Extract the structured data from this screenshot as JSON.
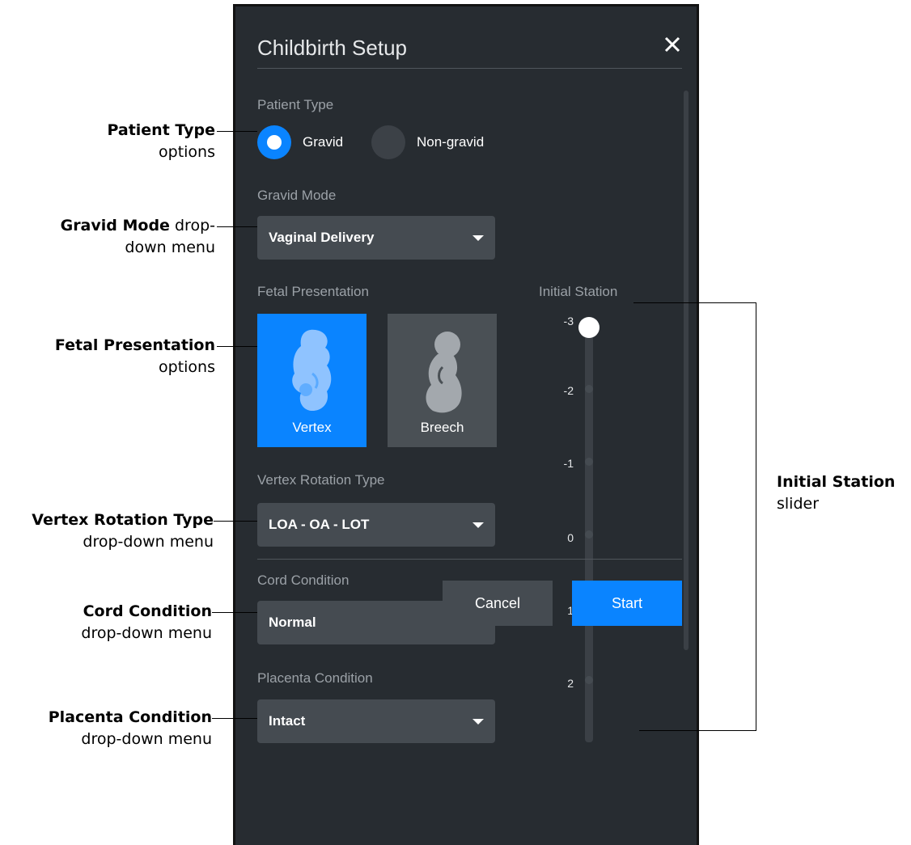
{
  "dialog": {
    "title": "Childbirth Setup",
    "close_icon": "close-icon",
    "patient_type": {
      "label": "Patient Type",
      "options": [
        {
          "label": "Gravid",
          "selected": true
        },
        {
          "label": "Non-gravid",
          "selected": false
        }
      ]
    },
    "gravid_mode": {
      "label": "Gravid Mode",
      "value": "Vaginal Delivery"
    },
    "fetal_presentation": {
      "label": "Fetal Presentation",
      "options": [
        {
          "label": "Vertex",
          "selected": true,
          "icon": "fetus-vertex-icon"
        },
        {
          "label": "Breech",
          "selected": false,
          "icon": "fetus-breech-icon"
        }
      ]
    },
    "vertex_rotation_type": {
      "label": "Vertex Rotation Type",
      "value": "LOA - OA - LOT"
    },
    "cord_condition": {
      "label": "Cord Condition",
      "value": "Normal"
    },
    "placenta_condition": {
      "label": "Placenta Condition",
      "value": "Intact"
    },
    "initial_station": {
      "label": "Initial Station",
      "ticks": [
        "-3",
        "-2",
        "-1",
        "0",
        "1",
        "2"
      ],
      "value": "-3"
    },
    "buttons": {
      "cancel": "Cancel",
      "start": "Start"
    },
    "colors": {
      "accent": "#0a84ff",
      "background": "#272c31",
      "control": "#454b51"
    }
  },
  "annotations": {
    "patient_type": {
      "bold": "Patient Type",
      "rest": "options"
    },
    "gravid_mode": {
      "bold": "Gravid Mode",
      "rest_line1": " drop-",
      "rest_line2": "down menu"
    },
    "fetal_presentation": {
      "bold": "Fetal Presentation",
      "rest": "options"
    },
    "vertex_rotation_type": {
      "bold": "Vertex Rotation Type",
      "rest": "drop-down menu"
    },
    "cord_condition": {
      "bold": "Cord Condition",
      "rest": "drop-down menu"
    },
    "placenta_condition": {
      "bold": "Placenta Condition",
      "rest": "drop-down menu"
    },
    "initial_station": {
      "bold": "Initial Station",
      "rest": "slider"
    }
  }
}
